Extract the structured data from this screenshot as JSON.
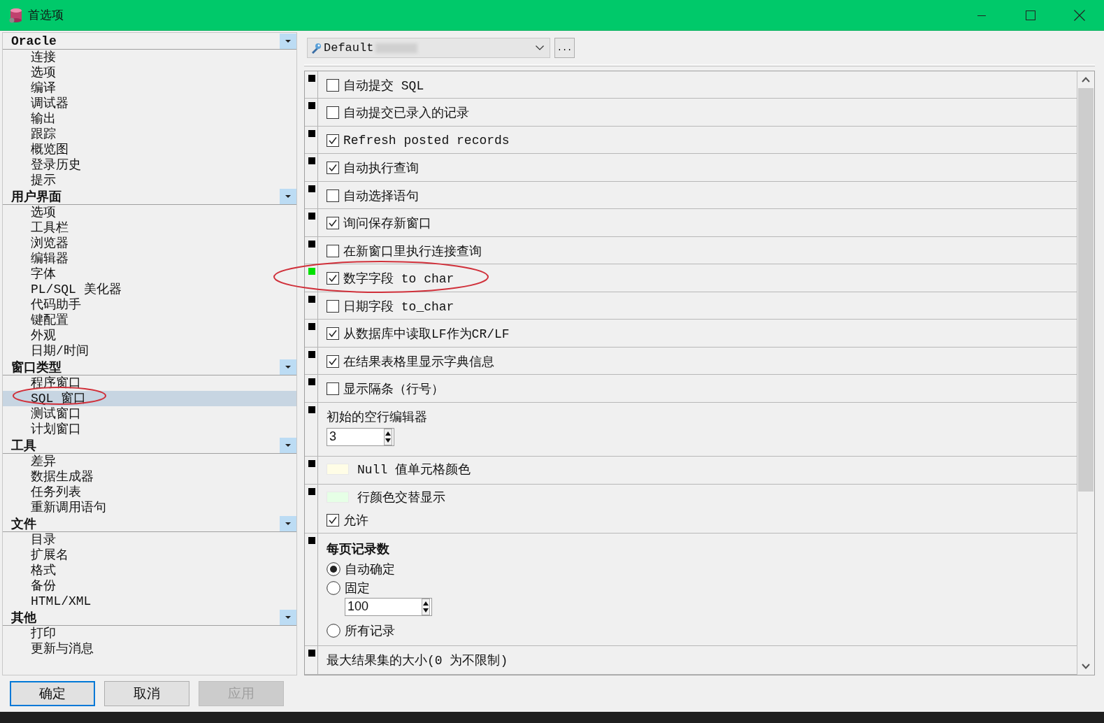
{
  "window": {
    "title": "首选项"
  },
  "sidebar": {
    "groups": [
      {
        "title": "Oracle",
        "items": [
          {
            "label": "连接",
            "selected": false
          },
          {
            "label": "选项",
            "selected": false
          },
          {
            "label": "编译",
            "selected": false
          },
          {
            "label": "调试器",
            "selected": false
          },
          {
            "label": "输出",
            "selected": false
          },
          {
            "label": "跟踪",
            "selected": false
          },
          {
            "label": "概览图",
            "selected": false
          },
          {
            "label": "登录历史",
            "selected": false
          },
          {
            "label": "提示",
            "selected": false
          }
        ]
      },
      {
        "title": "用户界面",
        "items": [
          {
            "label": "选项",
            "selected": false
          },
          {
            "label": "工具栏",
            "selected": false
          },
          {
            "label": "浏览器",
            "selected": false
          },
          {
            "label": "编辑器",
            "selected": false
          },
          {
            "label": "字体",
            "selected": false
          },
          {
            "label": "PL/SQL 美化器",
            "selected": false
          },
          {
            "label": "代码助手",
            "selected": false
          },
          {
            "label": "键配置",
            "selected": false
          },
          {
            "label": "外观",
            "selected": false
          },
          {
            "label": "日期/时间",
            "selected": false
          }
        ]
      },
      {
        "title": "窗口类型",
        "items": [
          {
            "label": "程序窗口",
            "selected": false
          },
          {
            "label": "SQL 窗口",
            "selected": true
          },
          {
            "label": "测试窗口",
            "selected": false
          },
          {
            "label": "计划窗口",
            "selected": false
          }
        ]
      },
      {
        "title": "工具",
        "items": [
          {
            "label": "差异",
            "selected": false
          },
          {
            "label": "数据生成器",
            "selected": false
          },
          {
            "label": "任务列表",
            "selected": false
          },
          {
            "label": "重新调用语句",
            "selected": false
          }
        ]
      },
      {
        "title": "文件",
        "items": [
          {
            "label": "目录",
            "selected": false
          },
          {
            "label": "扩展名",
            "selected": false
          },
          {
            "label": "格式",
            "selected": false
          },
          {
            "label": "备份",
            "selected": false
          },
          {
            "label": "HTML/XML",
            "selected": false
          }
        ]
      },
      {
        "title": "其他",
        "items": [
          {
            "label": "打印",
            "selected": false
          },
          {
            "label": "更新与消息",
            "selected": false
          }
        ]
      }
    ]
  },
  "profile": {
    "value": "Default",
    "button": "..."
  },
  "settings": [
    {
      "kind": "checkbox",
      "label": "自动提交 SQL",
      "checked": false,
      "color": "#000000"
    },
    {
      "kind": "checkbox",
      "label": "自动提交已录入的记录",
      "checked": false,
      "color": "#000000"
    },
    {
      "kind": "checkbox",
      "label": "Refresh posted records",
      "checked": true,
      "color": "#000000"
    },
    {
      "kind": "checkbox",
      "label": "自动执行查询",
      "checked": true,
      "color": "#000000"
    },
    {
      "kind": "checkbox",
      "label": "自动选择语句",
      "checked": false,
      "color": "#000000"
    },
    {
      "kind": "checkbox",
      "label": "询问保存新窗口",
      "checked": true,
      "color": "#000000"
    },
    {
      "kind": "checkbox",
      "label": "在新窗口里执行连接查询",
      "checked": false,
      "color": "#000000"
    },
    {
      "kind": "checkbox",
      "label": "数字字段 to char",
      "checked": true,
      "color": "#00e000"
    },
    {
      "kind": "checkbox",
      "label": "日期字段 to_char",
      "checked": false,
      "color": "#000000"
    },
    {
      "kind": "checkbox",
      "label": "从数据库中读取LF作为CR/LF",
      "checked": true,
      "color": "#000000"
    },
    {
      "kind": "checkbox",
      "label": "在结果表格里显示字典信息",
      "checked": true,
      "color": "#000000"
    },
    {
      "kind": "checkbox",
      "label": "显示隔条（行号）",
      "checked": false,
      "color": "#000000"
    },
    {
      "kind": "spin",
      "label": "初始的空行编辑器",
      "value": "3",
      "color": "#000000"
    },
    {
      "kind": "color",
      "label": "Null 值单元格颜色",
      "swatch": {
        "color": "#fffde6"
      },
      "color": "#000000"
    },
    {
      "kind": "color_toggle",
      "label": "行颜色交替显示",
      "swatch": {
        "color": "#e6ffe6"
      },
      "toggle_label": "允许",
      "checked": true,
      "color": "#000000"
    },
    {
      "kind": "radio_group",
      "title": "每页记录数",
      "color": "#000000",
      "options": [
        {
          "label": "自动确定",
          "selected": true
        },
        {
          "label": "固定",
          "selected": false,
          "spin_value": "100"
        },
        {
          "label": "所有记录",
          "selected": false
        }
      ]
    },
    {
      "kind": "text",
      "label": "最大结果集的大小(0 为不限制)",
      "color": "#000000"
    }
  ],
  "buttons": [
    {
      "label": "确定",
      "default": true,
      "disabled": false
    },
    {
      "label": "取消",
      "default": false,
      "disabled": false
    },
    {
      "label": "应用",
      "default": false,
      "disabled": true
    }
  ]
}
